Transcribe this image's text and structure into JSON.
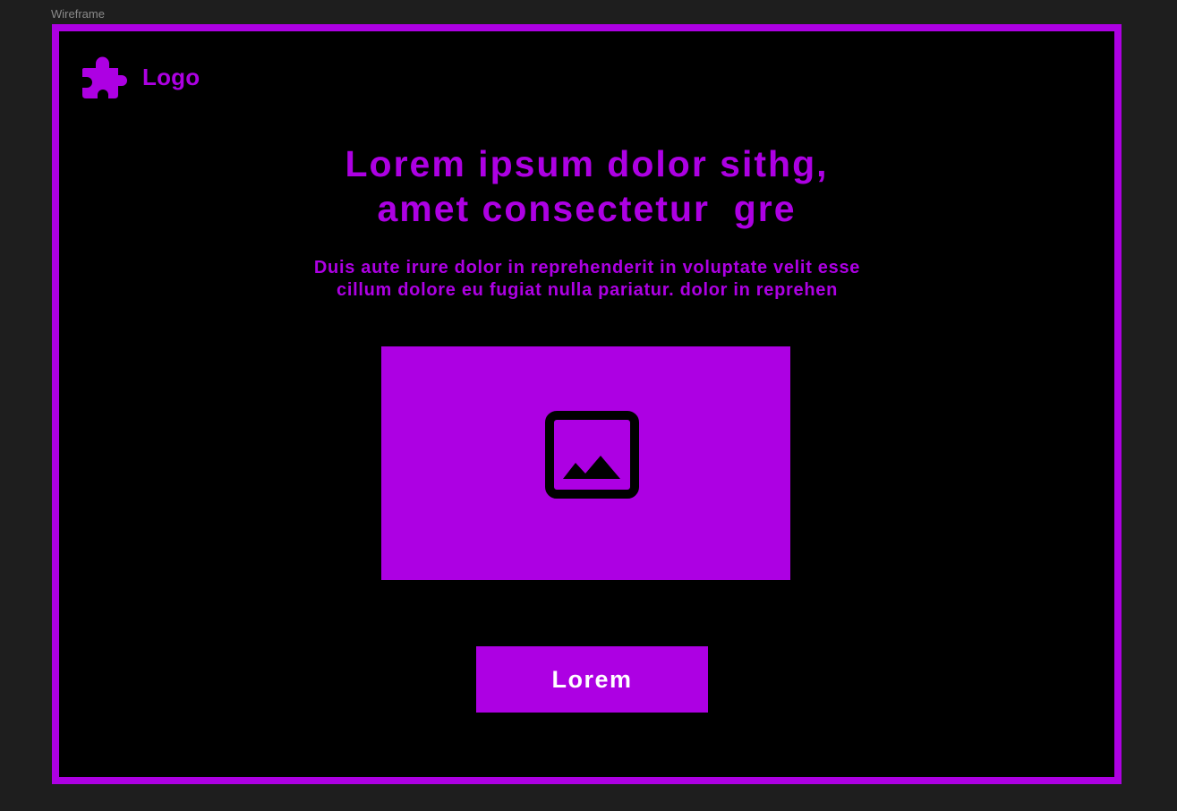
{
  "canvas": {
    "frame_label": "Wireframe"
  },
  "colors": {
    "accent": "#ad00e3",
    "frame_background": "#000000",
    "canvas_background": "#1e1e1e",
    "button_text": "#ffffff",
    "canvas_label": "#8a8a8a"
  },
  "header": {
    "logo_icon": "puzzle-piece-icon",
    "logo_text": "Logo"
  },
  "hero": {
    "headline_line1": "Lorem ipsum dolor sithg,",
    "headline_line2": "amet consectetur  gre",
    "subtext": "Duis aute irure dolor in reprehenderit in voluptate velit esse cillum dolore eu fugiat nulla pariatur.  dolor in reprehen",
    "image_icon": "image-icon",
    "button_label": "Lorem"
  }
}
